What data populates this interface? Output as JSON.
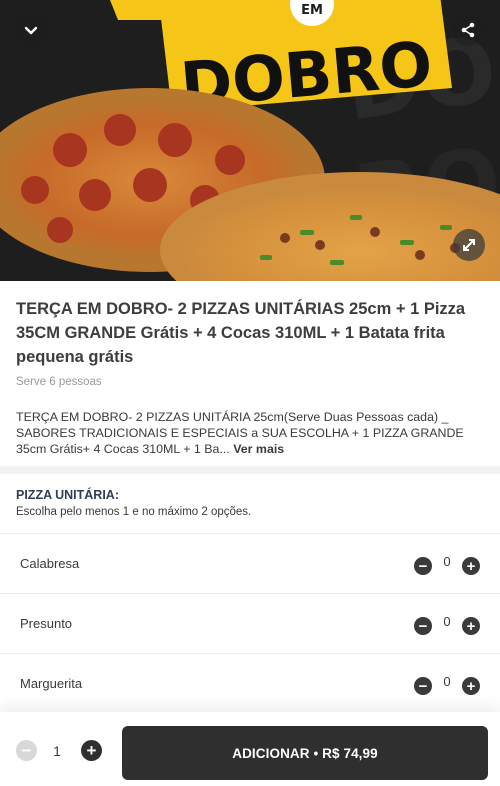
{
  "hero": {
    "banner_text": "DOBRO",
    "badge_text": "EM"
  },
  "product": {
    "title": "TERÇA EM DOBRO- 2 PIZZAS UNITÁRIAS 25cm + 1 Pizza 35CM GRANDE Grátis + 4 Cocas 310ML + 1 Batata frita pequena grátis",
    "serves": "Serve 6 pessoas",
    "description": "TERÇA EM DOBRO- 2 PIZZAS UNITÁRIA 25cm(Serve Duas Pessoas cada) _ SABORES TRADICIONAIS E ESPECIAIS a SUA ESCOLHA + 1 PIZZA GRANDE 35cm Grátis+ 4 Cocas 310ML + 1 Ba...",
    "see_more": "Ver mais"
  },
  "option_group": {
    "title": "PIZZA UNITÁRIA:",
    "subtitle": "Escolha pelo menos 1 e no máximo 2 opções.",
    "items": [
      {
        "name": "Calabresa",
        "qty": "0"
      },
      {
        "name": "Presunto",
        "qty": "0"
      },
      {
        "name": "Marguerita",
        "qty": "0"
      }
    ]
  },
  "footer": {
    "quantity": "1",
    "add_label": "ADICIONAR • R$ 74,99"
  },
  "icons": {
    "back": "chevron-down-icon",
    "share": "share-icon",
    "expand": "expand-icon",
    "minus": "minus-icon",
    "plus": "plus-icon"
  },
  "colors": {
    "banner_yellow": "#f5c518",
    "button_dark": "#2f2f2f",
    "group_title": "#2f3e57"
  }
}
